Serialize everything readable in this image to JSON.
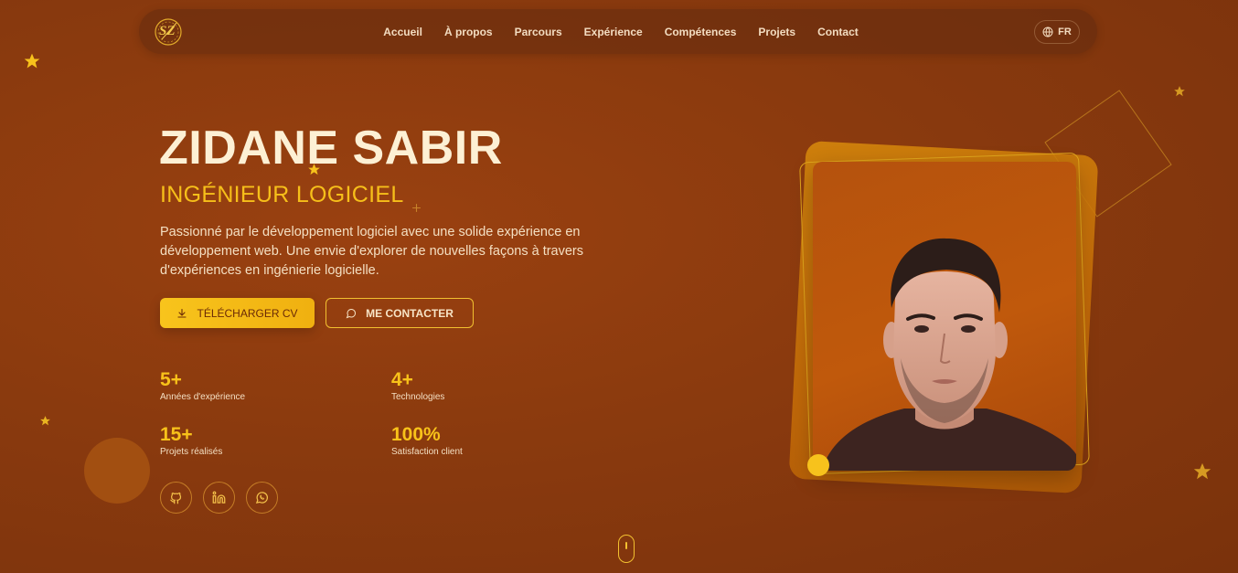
{
  "nav": {
    "logo_text": "SZ",
    "links": [
      "Accueil",
      "À propos",
      "Parcours",
      "Expérience",
      "Compétences",
      "Projets",
      "Contact"
    ],
    "lang": "FR"
  },
  "hero": {
    "name": "ZIDANE SABIR",
    "role": "INGÉNIEUR LOGICIEL",
    "description": "Passionné par le développement logiciel avec une solide expérience en développement web. Une envie d'explorer de nouvelles façons à travers d'expériences en ingénierie logicielle.",
    "cv_button": "TÉLÉCHARGER CV",
    "contact_button": "ME CONTACTER"
  },
  "stats": [
    {
      "value": "5+",
      "label": "Années d'expérience"
    },
    {
      "value": "4+",
      "label": "Technologies"
    },
    {
      "value": "15+",
      "label": "Projets réalisés"
    },
    {
      "value": "100%",
      "label": "Satisfaction client"
    }
  ],
  "social": [
    "github-icon",
    "linkedin-icon",
    "whatsapp-icon"
  ],
  "colors": {
    "accent": "#f6bf1a",
    "background": "#8a3a0e",
    "text": "#fdf0d4"
  }
}
